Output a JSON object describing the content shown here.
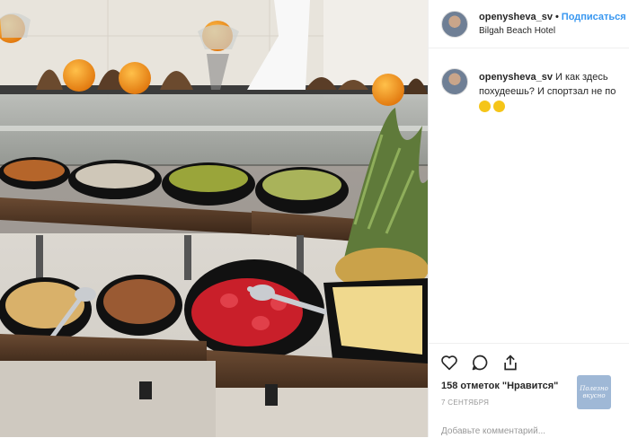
{
  "post": {
    "username": "openysheva_sv",
    "follow_label": "Подписаться",
    "location": "Bilgah Beach Hotel"
  },
  "caption": {
    "username": "openysheva_sv",
    "line1": "И как здесь",
    "line2": "похудеешь? И спортзал не по",
    "emojis": [
      "pensive-face-icon",
      "smiling-face-icon"
    ]
  },
  "actions": {
    "likes": "158 отметок \"Нравится\"",
    "date": "7 СЕНТЯБРЯ",
    "add_comment_placeholder": "Добавьте комментарий...",
    "stamp_text": "Полезно вкусно"
  },
  "colors": {
    "accent": "#3897f0",
    "text": "#262626",
    "muted": "#999999",
    "divider": "#efefef"
  }
}
